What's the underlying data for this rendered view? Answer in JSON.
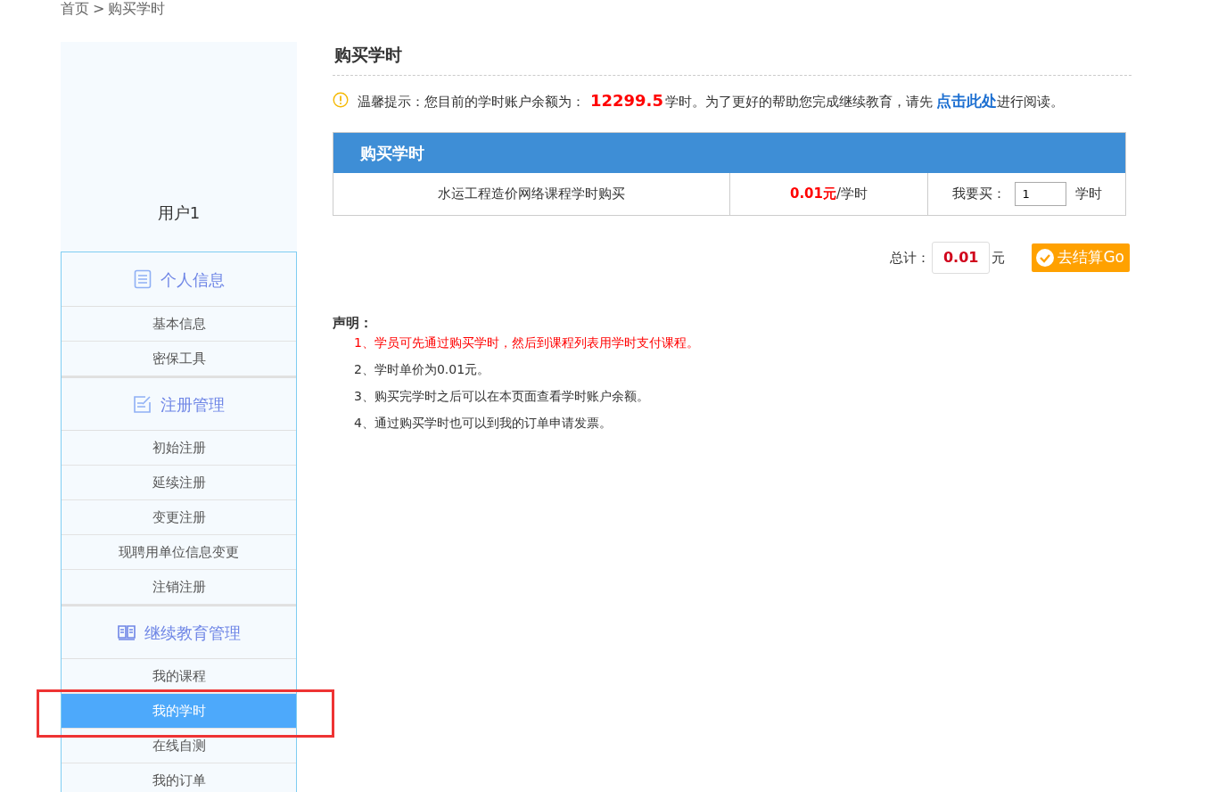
{
  "breadcrumb": {
    "home": "首页",
    "separator": ">",
    "current": "购买学时"
  },
  "sidebar": {
    "user_name": "用户1",
    "groups": [
      {
        "title": "个人信息",
        "items": [
          {
            "label": "基本信息",
            "selected": false
          },
          {
            "label": "密保工具",
            "selected": false
          }
        ]
      },
      {
        "title": "注册管理",
        "items": [
          {
            "label": "初始注册",
            "selected": false
          },
          {
            "label": "延续注册",
            "selected": false
          },
          {
            "label": "变更注册",
            "selected": false
          },
          {
            "label": "现聘用单位信息变更",
            "selected": false
          },
          {
            "label": "注销注册",
            "selected": false
          }
        ]
      },
      {
        "title": "继续教育管理",
        "items": [
          {
            "label": "我的课程",
            "selected": false
          },
          {
            "label": "我的学时",
            "selected": true
          },
          {
            "label": "在线自测",
            "selected": false
          },
          {
            "label": "我的订单",
            "selected": false
          }
        ]
      }
    ]
  },
  "page_title": "购买学时",
  "notice": {
    "prefix": "温馨提示：您目前的学时账户余额为：",
    "balance": "12299.5",
    "middle": "学时。为了更好的帮助您完成继续教育，请先",
    "link": "点击此处",
    "suffix": "进行阅读。"
  },
  "purchase_table": {
    "header": "购买学时",
    "product": "水运工程造价网络课程学时购买",
    "price": "0.01元",
    "price_unit": "/学时",
    "quantity_label": "我要买：",
    "quantity": "1",
    "quantity_unit": "学时"
  },
  "total": {
    "label": "总计：",
    "amount": "0.01",
    "unit": "元",
    "checkout_button": "去结算Go"
  },
  "declaration": {
    "title": "声明：",
    "items": [
      {
        "text": "1、学员可先通过购买学时，然后到课程列表用学时支付课程。",
        "emphasized": true
      },
      {
        "text": "2、学时单价为0.01元。",
        "emphasized": false
      },
      {
        "text": "3、购买完学时之后可以在本页面查看学时账户余额。",
        "emphasized": false
      },
      {
        "text": "4、通过购买学时也可以到我的订单申请发票。",
        "emphasized": false
      }
    ]
  },
  "highlight_frame": true
}
